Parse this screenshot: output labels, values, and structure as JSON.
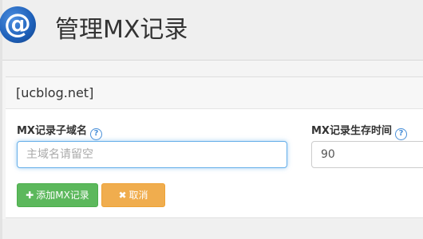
{
  "header": {
    "logo_text": "@",
    "title": "管理MX记录"
  },
  "panel": {
    "domain": "[ucblog.net]"
  },
  "form": {
    "subdomain_label": "MX记录子域名",
    "subdomain_placeholder": "主域名请留空",
    "subdomain_value": "",
    "ttl_label": "MX记录生存时间",
    "ttl_value": "90",
    "help_glyph": "?"
  },
  "buttons": {
    "add_icon": "✚",
    "add_label": "添加MX记录",
    "cancel_icon": "✖",
    "cancel_label": "取消"
  },
  "colors": {
    "add_button": "#5cb85c",
    "cancel_button": "#f0ad4e",
    "help_icon": "#4a90d9",
    "logo": "#1d5fb8"
  }
}
